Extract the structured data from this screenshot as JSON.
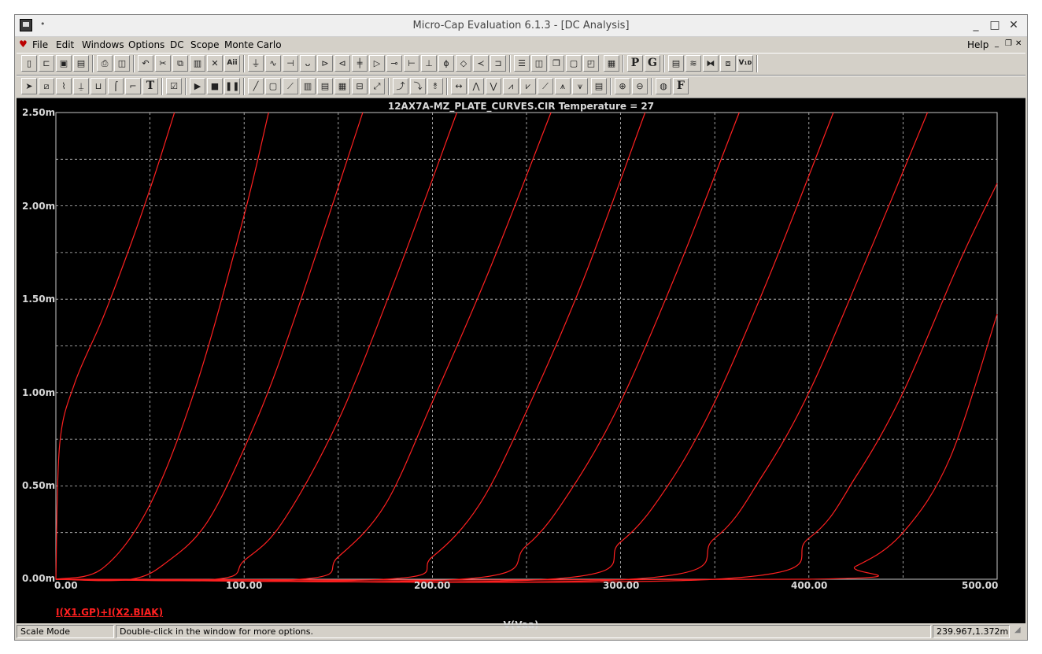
{
  "window": {
    "title": "Micro-Cap Evaluation 6.1.3 - [DC Analysis]",
    "title_dot": "•",
    "controls": {
      "minimize": "_",
      "maximize": "□",
      "close": "✕"
    }
  },
  "menubar": {
    "items": [
      "File",
      "Edit",
      "Windows",
      "Options",
      "DC",
      "Scope",
      "Monte Carlo"
    ],
    "help": "Help",
    "mdi_controls": {
      "minimize": "_",
      "restore": "❐",
      "close": "✕"
    }
  },
  "toolbar1": {
    "buttons": [
      "new-icon",
      "open-icon",
      "save-icon",
      "save-all-icon",
      "print-icon",
      "print-preview-icon",
      "undo-icon",
      "cut-icon",
      "copy-icon",
      "paste-icon",
      "clear-icon",
      "select-all-icon",
      "ground-icon",
      "resistor-icon",
      "capacitor-icon",
      "inductor-icon",
      "diode-icon",
      "bjt-icon",
      "mosfet-icon",
      "opamp-icon",
      "battery-icon",
      "source-icon",
      "current-source-icon",
      "voltage-icon",
      "wire-icon",
      "node-icon",
      "tile-horizontal-icon",
      "tile-vertical-icon",
      "cascade-icon",
      "window-icon",
      "window2-icon",
      "calculator-icon",
      "probe-p-icon",
      "probe-g-icon",
      "grid-icon",
      "waveform-icon",
      "component-icon",
      "preview-icon",
      "vid-icon"
    ],
    "text_buttons": {
      "p": "P",
      "g": "G",
      "aii": "Aii",
      "vid": "V₁ᴅ"
    }
  },
  "toolbar2": {
    "buttons": [
      "select-arrow-icon",
      "zoom-window-icon",
      "cursor-icon",
      "scale-icon",
      "data-icon",
      "waveform-tool-icon",
      "graph-tool-icon",
      "text-tool-icon",
      "properties-icon",
      "run-icon",
      "stop-icon",
      "pause-icon",
      "line-icon",
      "rectangle-icon",
      "diagonal-icon",
      "hatch1-icon",
      "hatch2-icon",
      "grid-tool-icon",
      "box-icon",
      "slope-icon",
      "peak-icon",
      "valley-icon",
      "high-icon",
      "low-icon",
      "cursor-mode-icon",
      "peak-find-icon",
      "valley-find-icon",
      "rise-icon",
      "fall-icon",
      "slope-find-icon",
      "inflection-icon",
      "min-icon",
      "table-icon",
      "zoom-in-icon",
      "zoom-out-icon",
      "help-tool-icon",
      "font-icon"
    ],
    "text_buttons": {
      "text": "T",
      "font": "F"
    }
  },
  "plot": {
    "title": "12AX7A-MZ_PLATE_CURVES.CIR Temperature = 27",
    "x_axis_label": "V(Vaa)",
    "legend": "I(X1.GP)+I(X2.BIAK)",
    "y_tick_labels": [
      "2.50m",
      "2.00m",
      "1.50m",
      "1.00m",
      "0.50m",
      "0.00m"
    ],
    "x_tick_labels": [
      "0.00",
      "100.00",
      "200.00",
      "300.00",
      "400.00",
      "500.00"
    ],
    "background": "#000000",
    "grid_color": "#c8c8c8",
    "trace_color": "#ff2020"
  },
  "chart_data": {
    "type": "line",
    "title": "12AX7A-MZ_PLATE_CURVES.CIR Temperature = 27",
    "xlabel": "V(Vaa)",
    "ylabel": "",
    "xlim": [
      0,
      500
    ],
    "ylim": [
      0,
      0.0025
    ],
    "grid": true,
    "series": [
      {
        "name": "I(X1.GP)+I(X2.BIAK)",
        "x": [
          0,
          2,
          10,
          25,
          40,
          52,
          63
        ],
        "y": [
          0.0,
          0.00072,
          0.00105,
          0.0014,
          0.0018,
          0.00215,
          0.0025
        ]
      },
      {
        "x": [
          0,
          25,
          50,
          75,
          100,
          113
        ],
        "y": [
          0.0,
          6e-05,
          0.0004,
          0.00105,
          0.00195,
          0.0025
        ]
      },
      {
        "x": [
          0,
          40,
          60,
          80,
          100,
          120,
          150,
          163
        ],
        "y": [
          0.0,
          0.0,
          0.0001,
          0.0003,
          0.0007,
          0.0012,
          0.0021,
          0.0025
        ]
      },
      {
        "x": [
          0,
          85,
          100,
          120,
          150,
          180,
          213
        ],
        "y": [
          0.0,
          0.0,
          0.0001,
          0.0003,
          0.00085,
          0.0016,
          0.0025
        ]
      },
      {
        "x": [
          0,
          130,
          150,
          175,
          200,
          230,
          263
        ],
        "y": [
          0.0,
          0.0,
          0.00012,
          0.0004,
          0.00095,
          0.00165,
          0.0025
        ]
      },
      {
        "x": [
          0,
          175,
          200,
          225,
          250,
          280,
          313
        ],
        "y": [
          0.0,
          0.0,
          0.00012,
          0.0004,
          0.0009,
          0.0016,
          0.0025
        ]
      },
      {
        "x": [
          0,
          215,
          250,
          275,
          300,
          330,
          363
        ],
        "y": [
          0.0,
          0.0,
          0.00018,
          0.0005,
          0.00095,
          0.00165,
          0.0025
        ]
      },
      {
        "x": [
          0,
          262,
          300,
          325,
          350,
          380,
          413
        ],
        "y": [
          0.0,
          0.0,
          0.0002,
          0.0005,
          0.00095,
          0.00165,
          0.0025
        ]
      },
      {
        "x": [
          0,
          305,
          350,
          375,
          400,
          430,
          463
        ],
        "y": [
          0.0,
          0.0,
          0.00022,
          0.00055,
          0.001,
          0.0017,
          0.0025
        ]
      },
      {
        "x": [
          0,
          350,
          400,
          425,
          450,
          480,
          500
        ],
        "y": [
          0.0,
          0.0,
          0.00022,
          0.00055,
          0.001,
          0.0017,
          0.00212
        ]
      },
      {
        "x": [
          0,
          400,
          425,
          450,
          475,
          500
        ],
        "y": [
          0.0,
          0.0,
          7e-05,
          0.00025,
          0.00065,
          0.00142
        ]
      }
    ]
  },
  "statusbar": {
    "mode": "Scale Mode",
    "hint": "Double-click in the window for more options.",
    "coords": "239.967,1.372m"
  }
}
